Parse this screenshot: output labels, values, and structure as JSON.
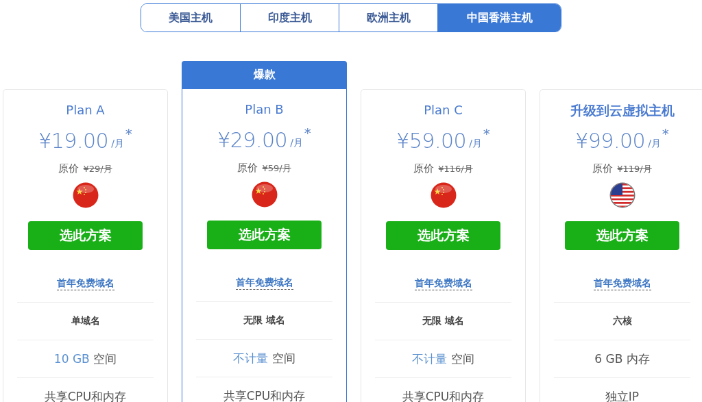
{
  "tabs": [
    {
      "label": "美国主机",
      "selected": false
    },
    {
      "label": "印度主机",
      "selected": false
    },
    {
      "label": "欧洲主机",
      "selected": false
    },
    {
      "label": "中国香港主机",
      "selected": true
    }
  ],
  "plans": [
    {
      "kind": "plan",
      "name": "Plan A",
      "price": "¥19.00",
      "unit": "/月",
      "mark": "*",
      "original_label": "原价",
      "original_price": "¥29/月",
      "flag": {
        "kind": "china"
      },
      "button": "选此方案",
      "features": [
        {
          "kind": "link",
          "text": "首年免费域名"
        },
        {
          "kind": "bold",
          "text": "单域名"
        },
        {
          "kind": "plain",
          "highlight": "10 GB",
          "text": "空间"
        },
        {
          "kind": "plain",
          "text": "共享CPU和内存"
        }
      ]
    },
    {
      "kind": "plan",
      "name": "Plan B",
      "badge": "爆款",
      "price": "¥29.00",
      "unit": "/月",
      "mark": "*",
      "original_label": "原价",
      "original_price": "¥59/月",
      "flag": {
        "kind": "china"
      },
      "button": "选此方案",
      "features": [
        {
          "kind": "link",
          "text": "首年免费域名"
        },
        {
          "kind": "bold",
          "text": "无限 域名"
        },
        {
          "kind": "plain",
          "highlight": "不计量",
          "text": "空间"
        },
        {
          "kind": "plain",
          "text": "共享CPU和内存"
        }
      ]
    },
    {
      "kind": "plan",
      "name": "Plan C",
      "price": "¥59.00",
      "unit": "/月",
      "mark": "*",
      "original_label": "原价",
      "original_price": "¥116/月",
      "flag": {
        "kind": "china"
      },
      "button": "选此方案",
      "features": [
        {
          "kind": "link",
          "text": "首年免费域名"
        },
        {
          "kind": "bold",
          "text": "无限 域名"
        },
        {
          "kind": "plain",
          "highlight": "不计量",
          "text": "空间"
        },
        {
          "kind": "plain",
          "text": "共享CPU和内存"
        }
      ]
    },
    {
      "kind": "upgrade",
      "name": "升级到云虚拟主机",
      "price": "¥99.00",
      "unit": "/月",
      "mark": "*",
      "original_label": "原价",
      "original_price": "¥119/月",
      "flag": {
        "kind": "usa"
      },
      "button": "选此方案",
      "features": [
        {
          "kind": "link",
          "text": "首年免费域名"
        },
        {
          "kind": "bold",
          "text": "六核"
        },
        {
          "kind": "plain",
          "text": "6 GB 内存"
        },
        {
          "kind": "plain",
          "text": "独立IP"
        }
      ]
    }
  ]
}
